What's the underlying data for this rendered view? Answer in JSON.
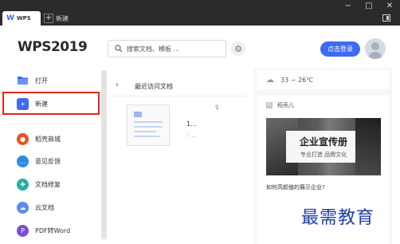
{
  "titlebar": {
    "home_tab_label": "WPS",
    "new_tab_label": "新建",
    "new_tab_icon": "plus-icon",
    "controls": [
      "minimize-icon",
      "maximize-icon",
      "close-icon"
    ]
  },
  "header": {
    "logo_text": "WPS2019",
    "search_placeholder": "搜索文档、模板 ...",
    "login_label": "点击登录"
  },
  "nav": {
    "primary": [
      {
        "label": "打开",
        "icon": "folder-icon",
        "color": "#3d6cf0"
      },
      {
        "label": "新建",
        "icon": "plus-square-icon",
        "color": "#3d6cf0"
      }
    ],
    "secondary": [
      {
        "label": "稻壳商城",
        "icon": "daoke-icon",
        "color": "#e8521f"
      },
      {
        "label": "意见反馈",
        "icon": "chat-bubble-icon",
        "color": "#2b8ce8"
      },
      {
        "label": "文档修复",
        "icon": "repair-icon",
        "color": "#22b0a0"
      },
      {
        "label": "云文档",
        "icon": "cloud-icon",
        "color": "#5b8def"
      },
      {
        "label": "PDF转Word",
        "icon": "pdf-icon",
        "color": "#7b4fd6"
      }
    ]
  },
  "recent": {
    "title": "最近访问文档",
    "doc_name": "1...",
    "doc_meta": "..."
  },
  "right_panel": {
    "weather_text": "33 ~ 26℃",
    "daoke_label": "稻壳儿",
    "banner_title": "企业宣传册",
    "banner_subtitle": "专业打造 品牌文化",
    "banner_caption": "如何高颜值的展示企业?"
  },
  "watermark": "最需教育",
  "colors": {
    "accent": "#3d6cf0",
    "titlebar": "#2b2b2b",
    "highlight": "#e0261b"
  }
}
